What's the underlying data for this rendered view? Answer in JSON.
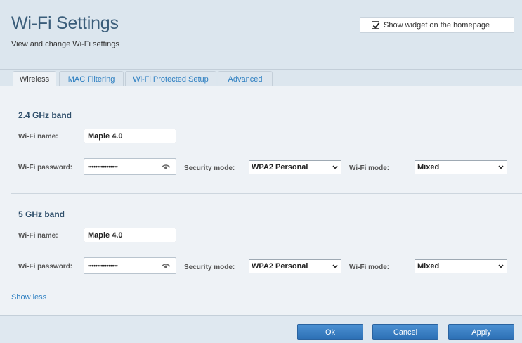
{
  "header": {
    "title": "Wi-Fi Settings",
    "subtitle": "View and change Wi-Fi settings",
    "widget_label": "Show widget on the homepage",
    "widget_checked": true
  },
  "tabs": [
    {
      "label": "Wireless",
      "active": true
    },
    {
      "label": "MAC Filtering",
      "active": false
    },
    {
      "label": "Wi-Fi Protected Setup",
      "active": false
    },
    {
      "label": "Advanced",
      "active": false
    }
  ],
  "bands": [
    {
      "title": "2.4 GHz band",
      "name_label": "Wi-Fi name:",
      "name_value": "Maple 4.0",
      "password_label": "Wi-Fi password:",
      "password_value": "••••••••••••••••",
      "security_label": "Security mode:",
      "security_value": "WPA2 Personal",
      "mode_label": "Wi-Fi mode:",
      "mode_value": "Mixed"
    },
    {
      "title": "5 GHz band",
      "name_label": "Wi-Fi name:",
      "name_value": "Maple 4.0",
      "password_label": "Wi-Fi password:",
      "password_value": "••••••••••••••••",
      "security_label": "Security mode:",
      "security_value": "WPA2 Personal",
      "mode_label": "Wi-Fi mode:",
      "mode_value": "Mixed"
    }
  ],
  "show_less": "Show less",
  "footer": {
    "ok_label": "Ok",
    "cancel_label": "Cancel",
    "apply_label": "Apply"
  },
  "colors": {
    "accent": "#2d7fc1",
    "title": "#3a5d7a",
    "button": "#3a80c6"
  }
}
